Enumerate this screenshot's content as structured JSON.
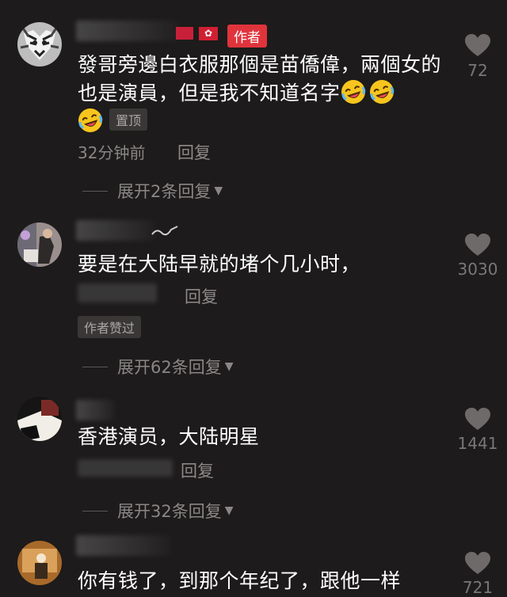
{
  "comments": [
    {
      "author_badge": "作者",
      "flag_label": "✿",
      "text": "發哥旁邊白衣服那個是苗僑偉，兩個女的也是演員，但是我不知道名字",
      "pinned_tag": "置顶",
      "time": "32分钟前",
      "reply_label": "回复",
      "expand_label": "展开2条回复",
      "likes": "72"
    },
    {
      "text": "要是在大陆早就的堵个几小时，",
      "reply_label": "回复",
      "liked_by_author_tag": "作者赞过",
      "expand_label": "展开62条回复",
      "likes": "3030"
    },
    {
      "text": "香港演员，大陆明星",
      "reply_label": "回复",
      "expand_label": "展开32条回复",
      "likes": "1441"
    },
    {
      "text": "你有钱了，到那个年纪了，跟他一样",
      "likes": "721"
    }
  ],
  "icons": {
    "like": "heart-icon",
    "laugh": "rofl-emoji",
    "caret": "caret-down-icon"
  },
  "colors": {
    "background": "#1d1b1b",
    "author_badge": "#e0343d",
    "text": "#ffffff",
    "muted": "#8a8686"
  }
}
